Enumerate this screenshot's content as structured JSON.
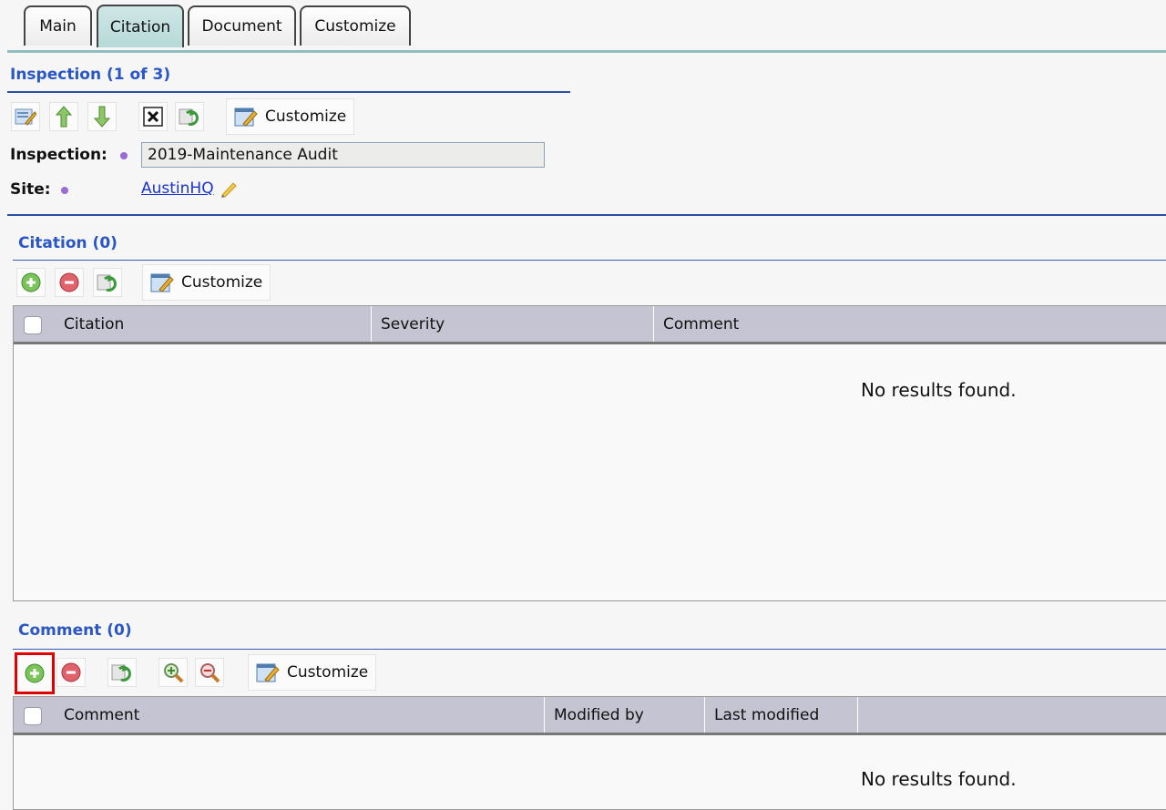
{
  "tabs": [
    {
      "label": "Main"
    },
    {
      "label": "Citation"
    },
    {
      "label": "Document"
    },
    {
      "label": "Customize"
    }
  ],
  "active_tab": "Citation",
  "inspection": {
    "title": "Inspection (1 of 3)",
    "customize_label": "Customize",
    "inspection_label": "Inspection:",
    "inspection_value": "2019-Maintenance Audit",
    "site_label": "Site:",
    "site_value": "AustinHQ"
  },
  "citation": {
    "title": "Citation (0)",
    "customize_label": "Customize",
    "columns": [
      "Citation",
      "Severity",
      "Comment"
    ],
    "empty_text": "No results found."
  },
  "comment": {
    "title": "Comment (0)",
    "customize_label": "Customize",
    "columns": [
      "Comment",
      "Modified by",
      "Last modified"
    ],
    "empty_text": "No results found."
  },
  "colors": {
    "section_title": "#2a56c6",
    "active_tab": "#b7d9d9",
    "highlight": "#e00000"
  }
}
